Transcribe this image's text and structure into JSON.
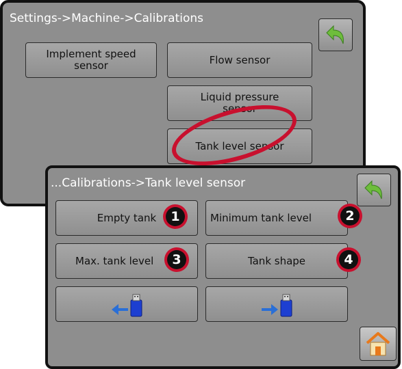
{
  "back_screen": {
    "breadcrumb": "Settings->Machine->Calibrations",
    "buttons": {
      "implement_speed": "Implement speed sensor",
      "flow_sensor": "Flow sensor",
      "liquid_pressure": "Liquid pressure sensor",
      "tank_level": "Tank level sensor"
    },
    "back_icon": "green-back-arrow-icon"
  },
  "front_screen": {
    "breadcrumb": "...Calibrations->Tank level sensor",
    "buttons": {
      "empty_tank": "Empty tank",
      "minimum_tank_level": "Minimum tank level",
      "max_tank_level": "Max. tank level",
      "tank_shape": "Tank shape"
    },
    "import_icon": "usb-import-icon",
    "export_icon": "usb-export-icon",
    "home_icon": "home-icon",
    "back_icon": "green-back-arrow-icon"
  },
  "callouts": [
    "1",
    "2",
    "3",
    "4"
  ],
  "colors": {
    "screen_bg": "#8e8e8e",
    "callout_red": "#c8102e",
    "arrow_green": "#6ebd3c",
    "usb_blue": "#1d3fd1"
  }
}
